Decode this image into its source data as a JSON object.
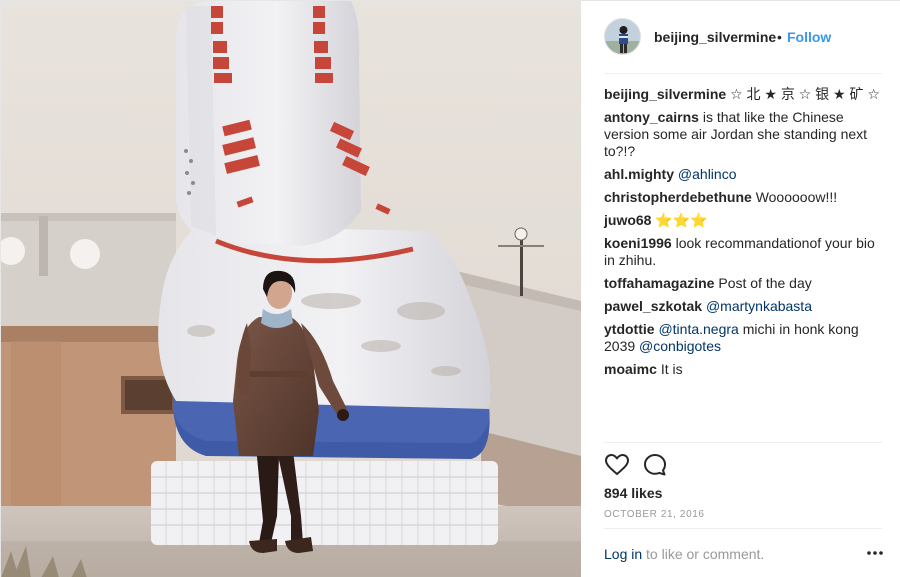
{
  "post": {
    "username": "beijing_silvermine",
    "separator": "•",
    "follow_label": "Follow",
    "caption_user": "beijing_silvermine",
    "caption_text": "☆ 北 ★ 京 ☆ 银 ★ 矿 ☆",
    "comments": [
      {
        "user": "antony_cairns",
        "mention": "",
        "text": "is that like the Chinese version some air Jordan she standing next to?!?"
      },
      {
        "user": "ahl.mighty",
        "mention": "@ahlinco",
        "text": ""
      },
      {
        "user": "christopherdebethune",
        "mention": "",
        "text": "Woooooow!!!"
      },
      {
        "user": "juwo68",
        "mention": "",
        "text": "⭐⭐⭐"
      },
      {
        "user": "koeni1996",
        "mention": "",
        "text": "look recommandationof your bio in zhihu."
      },
      {
        "user": "toffahamagazine",
        "mention": "",
        "text": "Post of the day"
      },
      {
        "user": "pawel_szkotak",
        "mention": "@martynkabasta",
        "text": ""
      },
      {
        "user": "ytdottie",
        "mention": "@tinta.negra",
        "text": "michi in honk kong 2039",
        "mention2": "@conbigotes"
      },
      {
        "user": "moaimc",
        "mention": "",
        "text": "It is"
      }
    ],
    "likes_count": "894",
    "likes_word": "likes",
    "date": "OCTOBER 21, 2016",
    "login_link": "Log in",
    "login_rest": "to like or comment."
  },
  "icons": {
    "like": "heart-outline-icon",
    "comment": "speech-bubble-icon",
    "more": "ellipsis-icon"
  },
  "colors": {
    "link_blue": "#3897f0",
    "mention_blue": "#003569",
    "muted": "#999999",
    "text": "#262626"
  }
}
